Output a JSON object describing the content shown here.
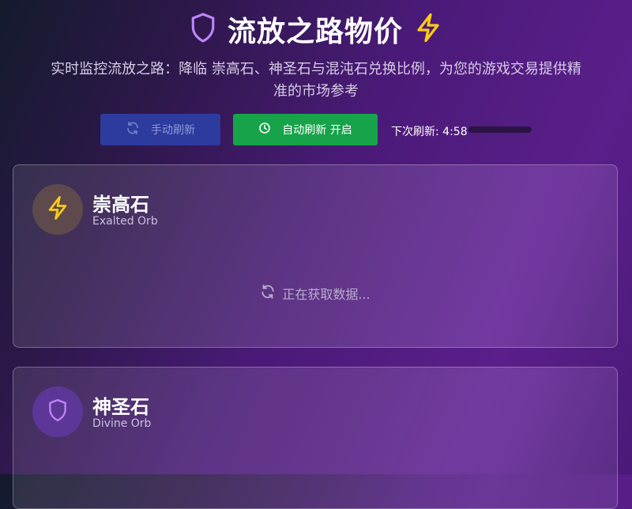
{
  "header": {
    "title": "流放之路物价",
    "title_left_icon": "shield-icon",
    "title_right_icon": "lightning-icon",
    "subtitle": "实时监控流放之路：降临 崇高石、神圣石与混沌石兑换比例，为您的游戏交易提供精准的市场参考"
  },
  "controls": {
    "manual_refresh_label": "手动刷新",
    "manual_refresh_icon": "refresh-icon",
    "auto_refresh_label": "自动刷新 开启",
    "auto_refresh_icon": "clock-icon",
    "next_refresh_label": "下次刷新: 4:58",
    "next_refresh_progress": 0
  },
  "cards": [
    {
      "title": "崇高石",
      "subtitle": "Exalted Orb",
      "icon": "lightning-icon",
      "icon_color": "#facc15",
      "loading_text": "正在获取数据..."
    },
    {
      "title": "神圣石",
      "subtitle": "Divine Orb",
      "icon": "shield-icon",
      "icon_color": "#c084fc"
    }
  ],
  "colors": {
    "manual_button": "#2d3a9e",
    "auto_button": "#16a34a",
    "accent_purple": "#c084fc",
    "accent_yellow": "#facc15"
  }
}
